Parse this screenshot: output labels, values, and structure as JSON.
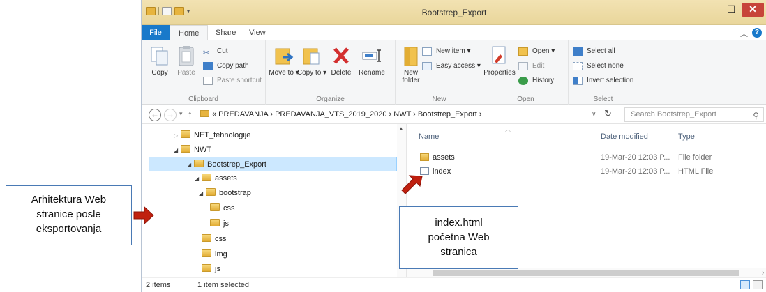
{
  "window": {
    "title": "Bootstrep_Export",
    "controls": {
      "minimize": "–",
      "maximize": "☐",
      "close": "✕"
    }
  },
  "tabs": {
    "file": "File",
    "home": "Home",
    "share": "Share",
    "view": "View"
  },
  "ribbon": {
    "clipboard": {
      "label": "Clipboard",
      "copy": "Copy",
      "paste": "Paste",
      "cut": "Cut",
      "copy_path": "Copy path",
      "paste_shortcut": "Paste shortcut"
    },
    "organize": {
      "label": "Organize",
      "move_to": "Move to ▾",
      "copy_to": "Copy to ▾",
      "delete": "Delete",
      "rename": "Rename"
    },
    "new": {
      "label": "New",
      "new_folder": "New folder",
      "new_item": "New item ▾",
      "easy_access": "Easy access ▾"
    },
    "open": {
      "label": "Open",
      "properties": "Properties",
      "open": "Open ▾",
      "edit": "Edit",
      "history": "History"
    },
    "select": {
      "label": "Select",
      "select_all": "Select all",
      "select_none": "Select none",
      "invert_selection": "Invert selection"
    }
  },
  "address": {
    "path": "« PREDAVANJA  ›  PREDAVANJA_VTS_2019_2020  ›  NWT  ›  Bootstrep_Export  ›",
    "search_placeholder": "Search Bootstrep_Export"
  },
  "tree": [
    {
      "label": "NET_tehnologije",
      "arrow": "▷"
    },
    {
      "label": "NWT",
      "arrow": "◢"
    },
    {
      "label": "Bootstrep_Export",
      "arrow": "◢"
    },
    {
      "label": "assets",
      "arrow": "◢"
    },
    {
      "label": "bootstrap",
      "arrow": "◢"
    },
    {
      "label": "css",
      "arrow": ""
    },
    {
      "label": "js",
      "arrow": ""
    },
    {
      "label": "css",
      "arrow": ""
    },
    {
      "label": "img",
      "arrow": ""
    },
    {
      "label": "js",
      "arrow": ""
    }
  ],
  "columns": {
    "name": "Name",
    "date": "Date modified",
    "type": "Type"
  },
  "files": [
    {
      "name": "assets",
      "date": "19-Mar-20 12:03 P...",
      "type": "File folder"
    },
    {
      "name": "index",
      "date": "19-Mar-20 12:03 P...",
      "type": "HTML File"
    }
  ],
  "status": {
    "items": "2 items",
    "selected": "1 item selected"
  },
  "callouts": {
    "left": [
      "Arhitektura  Web",
      "stranice posle",
      "eksportovanja"
    ],
    "mid": [
      "index.html",
      "početna Web",
      "stranica"
    ]
  },
  "colors": {
    "accent": "#1979ca",
    "arrow": "#c0200f",
    "callout_border": "#4a7ab5",
    "selection": "#cce8ff"
  }
}
